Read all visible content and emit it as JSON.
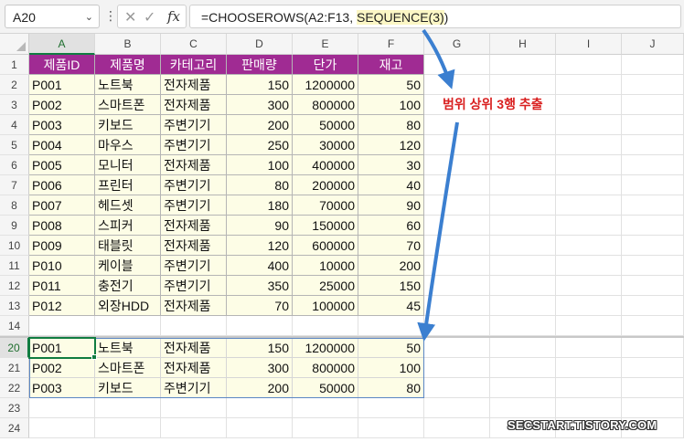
{
  "namebox": {
    "value": "A20",
    "dropdown_icon": "chevron-down-icon"
  },
  "formula_bar": {
    "more_icon": "vertical-dots-icon",
    "cancel_icon": "x-icon",
    "enter_icon": "check-icon",
    "fx_label": "fx",
    "formula_prefix": "=CHOOSEROWS(A2:F13, ",
    "formula_highlight": "SEQUENCE(3)",
    "formula_suffix": ")"
  },
  "columns": [
    "A",
    "B",
    "C",
    "D",
    "E",
    "F",
    "G",
    "H",
    "I",
    "J"
  ],
  "selected_column": "A",
  "rows_top": [
    "1",
    "2",
    "3",
    "4",
    "5",
    "6",
    "7",
    "8",
    "9",
    "10",
    "11",
    "12",
    "13",
    "14"
  ],
  "rows_bottom": [
    "20",
    "21",
    "22",
    "23",
    "24"
  ],
  "selected_row": "20",
  "table_headers": [
    "제품ID",
    "제품명",
    "카테고리",
    "판매량",
    "단가",
    "재고"
  ],
  "table_rows": [
    [
      "P001",
      "노트북",
      "전자제품",
      "150",
      "1200000",
      "50"
    ],
    [
      "P002",
      "스마트폰",
      "전자제품",
      "300",
      "800000",
      "100"
    ],
    [
      "P003",
      "키보드",
      "주변기기",
      "200",
      "50000",
      "80"
    ],
    [
      "P004",
      "마우스",
      "주변기기",
      "250",
      "30000",
      "120"
    ],
    [
      "P005",
      "모니터",
      "전자제품",
      "100",
      "400000",
      "30"
    ],
    [
      "P006",
      "프린터",
      "주변기기",
      "80",
      "200000",
      "40"
    ],
    [
      "P007",
      "헤드셋",
      "주변기기",
      "180",
      "70000",
      "90"
    ],
    [
      "P008",
      "스피커",
      "전자제품",
      "90",
      "150000",
      "60"
    ],
    [
      "P009",
      "태블릿",
      "전자제품",
      "120",
      "600000",
      "70"
    ],
    [
      "P010",
      "케이블",
      "주변기기",
      "400",
      "10000",
      "200"
    ],
    [
      "P011",
      "충전기",
      "주변기기",
      "350",
      "25000",
      "150"
    ],
    [
      "P012",
      "외장HDD",
      "전자제품",
      "70",
      "100000",
      "45"
    ]
  ],
  "result_rows": [
    [
      "P001",
      "노트북",
      "전자제품",
      "150",
      "1200000",
      "50"
    ],
    [
      "P002",
      "스마트폰",
      "전자제품",
      "300",
      "800000",
      "100"
    ],
    [
      "P003",
      "키보드",
      "주변기기",
      "200",
      "50000",
      "80"
    ]
  ],
  "annotation": "범위 상위 3행 추출",
  "watermark": "SECSTART.TISTORY.COM",
  "colors": {
    "header_fill": "#a02b93",
    "data_fill": "#fdfde6",
    "arrow": "#3b7fd0",
    "annotation": "#d92020",
    "selection": "#107c41"
  }
}
